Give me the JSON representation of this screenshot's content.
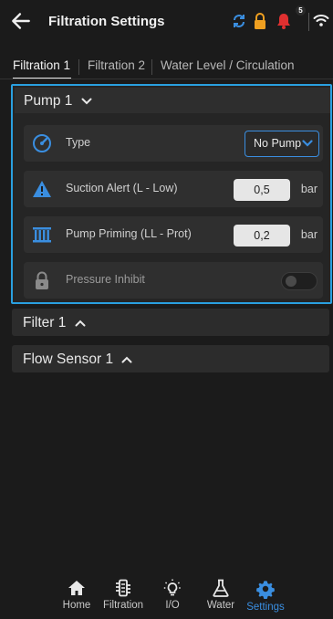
{
  "header": {
    "title": "Filtration Settings",
    "notification_count": "5",
    "icons": [
      "back-arrow-icon",
      "sync-icon",
      "lock-icon",
      "bell-icon",
      "wifi-icon"
    ]
  },
  "tabs": [
    {
      "label": "Filtration 1",
      "active": true
    },
    {
      "label": "Filtration 2",
      "active": false
    },
    {
      "label": "Water Level / Circulation",
      "active": false
    }
  ],
  "pump": {
    "title": "Pump 1",
    "expanded": true,
    "rows": {
      "type": {
        "label": "Type",
        "value": "No Pump"
      },
      "suction": {
        "label": "Suction Alert (L - Low)",
        "value": "0,5",
        "unit": "bar"
      },
      "priming": {
        "label": "Pump Priming (LL - Prot)",
        "value": "0,2",
        "unit": "bar"
      },
      "inhibit": {
        "label": "Pressure Inhibit",
        "enabled": false
      }
    }
  },
  "sections": {
    "filter": {
      "title": "Filter 1",
      "expanded": false
    },
    "flow": {
      "title": "Flow Sensor 1",
      "expanded": false
    }
  },
  "nav": {
    "home": "Home",
    "filtration": "Filtration",
    "io": "I/O",
    "water": "Water",
    "settings": "Settings",
    "active": "settings"
  },
  "colors": {
    "accent": "#3a8ee0",
    "highlight_border": "#2aa0e0",
    "background": "#1b1b1b",
    "lock": "#f0a020",
    "bell": "#e03030"
  }
}
